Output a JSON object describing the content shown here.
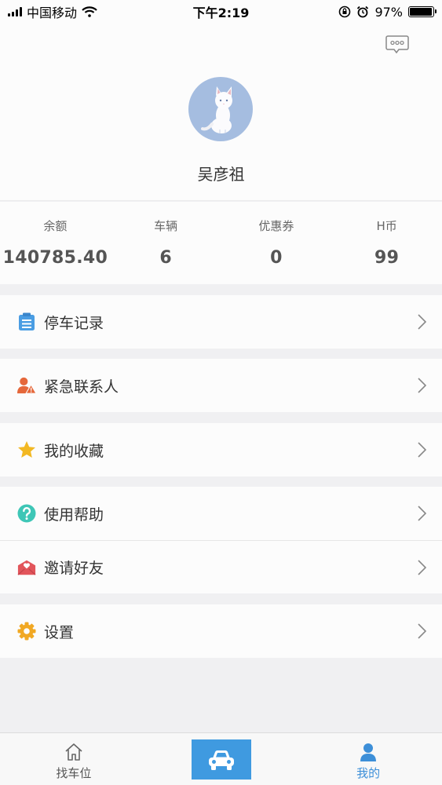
{
  "status_bar": {
    "carrier": "中国移动",
    "time": "下午2:19",
    "battery": "97%",
    "battery_level": 0.97
  },
  "profile": {
    "username": "吴彦祖",
    "message_icon": "chat-bubble-icon",
    "avatar_icon": "white-cat-avatar"
  },
  "stats": [
    {
      "label": "余额",
      "value": "140785.40"
    },
    {
      "label": "车辆",
      "value": "6"
    },
    {
      "label": "优惠券",
      "value": "0"
    },
    {
      "label": "H币",
      "value": "99"
    }
  ],
  "menu": [
    {
      "label": "停车记录",
      "icon": "clipboard-icon",
      "color": "#4a9de3"
    },
    {
      "label": "紧急联系人",
      "icon": "contact-alert-icon",
      "color": "#e5673a"
    },
    {
      "label": "我的收藏",
      "icon": "star-icon",
      "color": "#f2b823"
    },
    {
      "label": "使用帮助",
      "icon": "help-icon",
      "color": "#3ec6b6"
    },
    {
      "label": "邀请好友",
      "icon": "invite-envelope-icon",
      "color": "#e2555b"
    },
    {
      "label": "设置",
      "icon": "gear-icon",
      "color": "#f1a823"
    }
  ],
  "tab_bar": {
    "find_parking": "找车位",
    "mine": "我的",
    "accent": "#3d8fd8"
  }
}
